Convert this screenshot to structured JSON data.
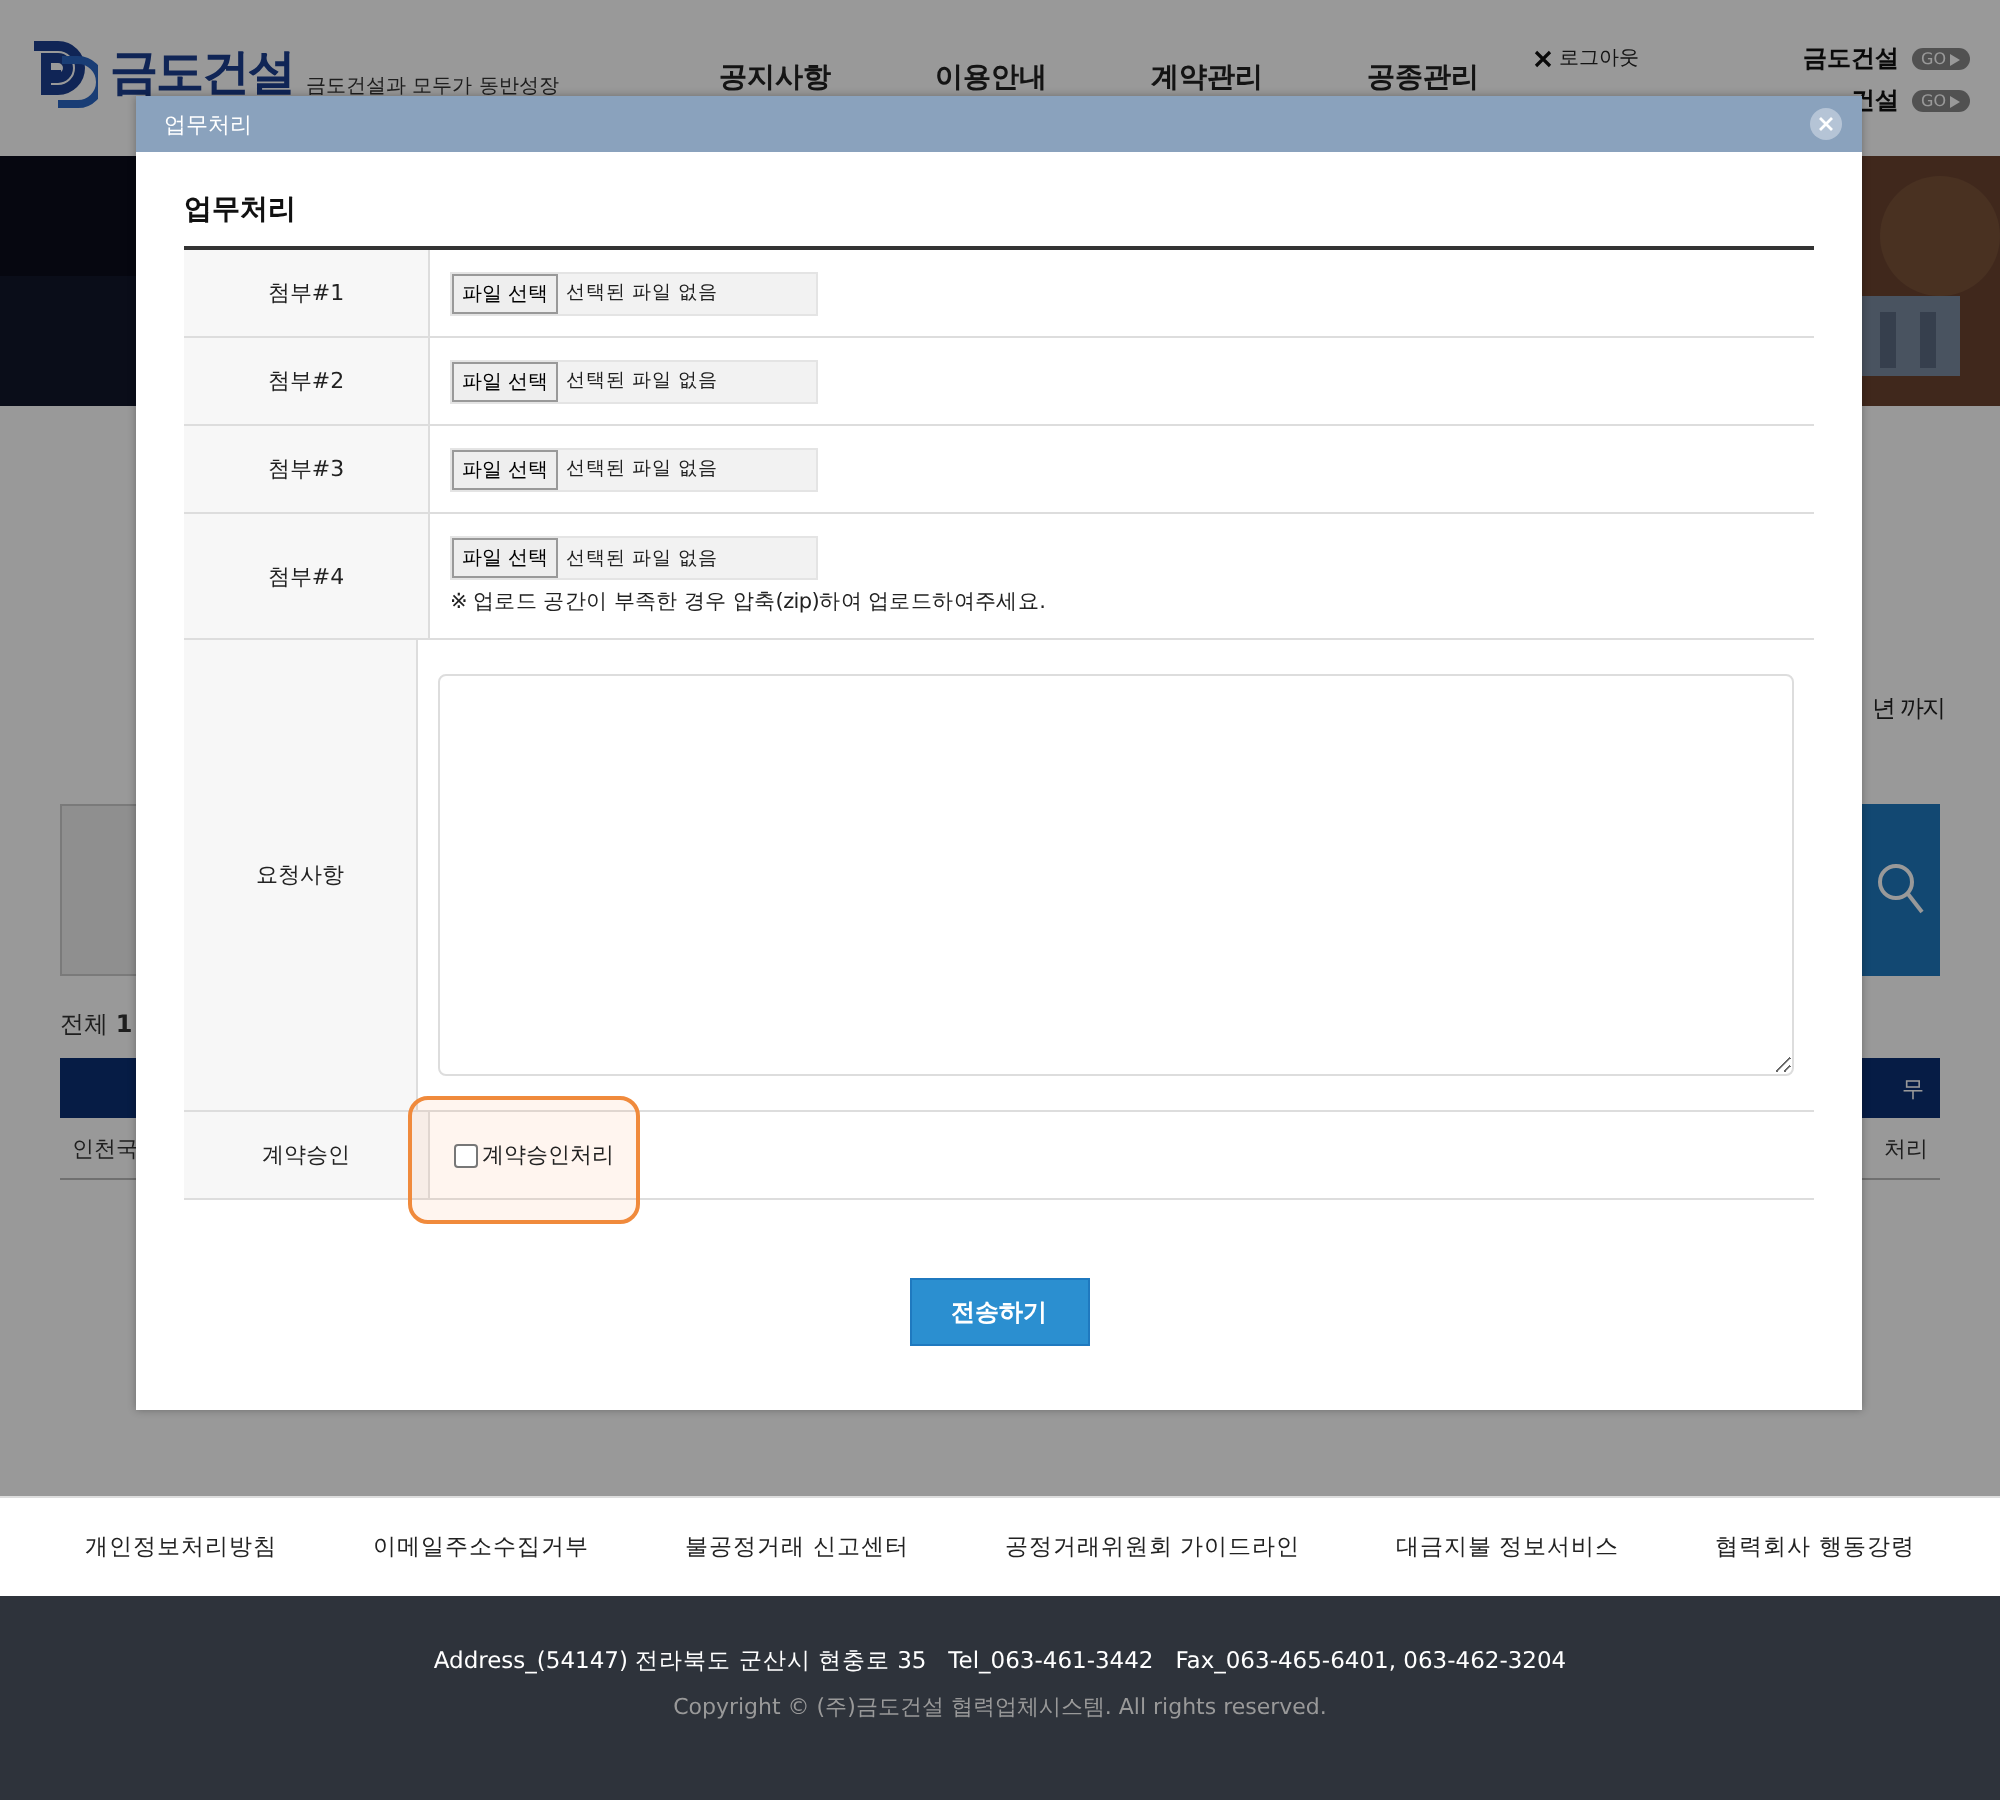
{
  "header": {
    "logo": "금도건설",
    "tagline": "금도건설과 모두가 동반성장",
    "nav": [
      "공지사항",
      "이용안내",
      "계약관리",
      "공종관리"
    ],
    "logout": "로그아웃",
    "sites": [
      {
        "name": "금도건설",
        "go": "GO"
      },
      {
        "name": "건설",
        "go": "GO"
      }
    ]
  },
  "background": {
    "period_suffix": "년 까지",
    "total_label": "전체",
    "total_count": "1",
    "table_header_tail": "무",
    "row_first": "인천국",
    "row_last": "처리"
  },
  "modal": {
    "title": "업무처리",
    "heading": "업무처리",
    "attachments": [
      {
        "label": "첨부#1",
        "button": "파일 선택",
        "status": "선택된 파일 없음"
      },
      {
        "label": "첨부#2",
        "button": "파일 선택",
        "status": "선택된 파일 없음"
      },
      {
        "label": "첨부#3",
        "button": "파일 선택",
        "status": "선택된 파일 없음"
      },
      {
        "label": "첨부#4",
        "button": "파일 선택",
        "status": "선택된 파일 없음"
      }
    ],
    "note": "※ 업로드 공간이 부족한 경우 압축(zip)하여 업로드하여주세요.",
    "request_label": "요청사항",
    "approval": {
      "label": "계약승인",
      "checkbox_label": "계약승인처리",
      "checked": false
    },
    "submit": "전송하기"
  },
  "footer": {
    "links": [
      "개인정보처리방침",
      "이메일주소수집거부",
      "불공정거래 신고센터",
      "공정거래위원회 가이드라인",
      "대금지불 정보서비스",
      "협력회사 행동강령"
    ],
    "address": "Address_(54147) 전라북도 군산시 현충로 35   Tel_063-461-3442   Fax_063-465-6401, 063-462-3204",
    "copyright": "Copyright © (주)금도건설 협력업체시스템. All rights reserved."
  }
}
